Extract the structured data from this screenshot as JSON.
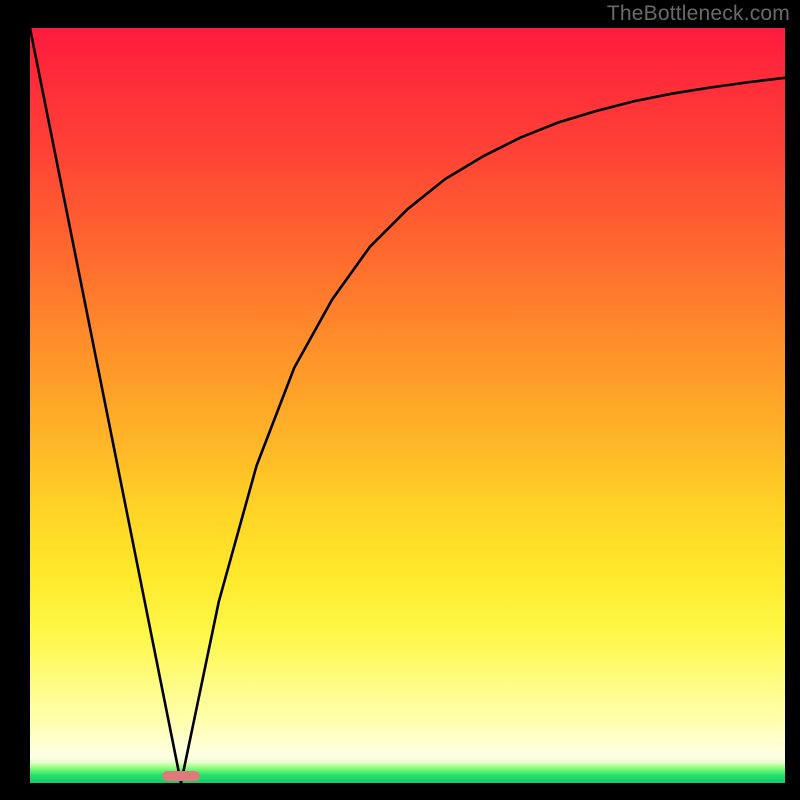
{
  "watermark": "TheBottleneck.com",
  "chart_data": {
    "type": "line",
    "title": "",
    "xlabel": "",
    "ylabel": "",
    "xlim": [
      0,
      100
    ],
    "ylim": [
      0,
      100
    ],
    "grid": false,
    "legend": false,
    "series": [
      {
        "name": "left-linear-segment",
        "x": [
          0,
          20
        ],
        "y": [
          100,
          0
        ]
      },
      {
        "name": "right-asymptotic-curve",
        "x": [
          20,
          25,
          30,
          35,
          40,
          45,
          50,
          55,
          60,
          65,
          70,
          75,
          80,
          85,
          90,
          95,
          100
        ],
        "y": [
          0,
          24,
          42,
          55,
          64,
          71,
          76,
          80,
          83,
          85.5,
          87.5,
          89,
          90.3,
          91.3,
          92.1,
          92.8,
          93.4
        ]
      }
    ],
    "marker": {
      "x_center": 20,
      "width_pct": 4.8,
      "color": "#e07a7a"
    },
    "background_gradient": {
      "top": "#ff1a3f",
      "mid": "#ffd426",
      "bottom": "#17c964"
    },
    "curve_color": "#000000"
  }
}
